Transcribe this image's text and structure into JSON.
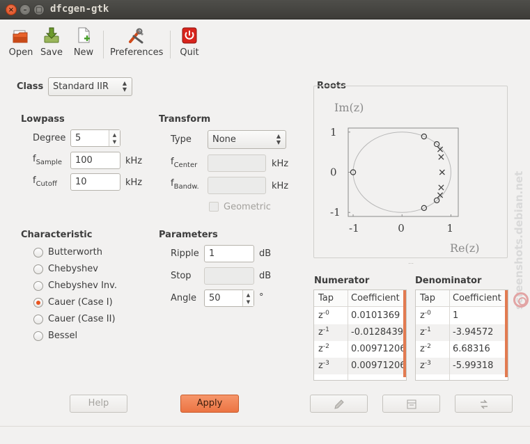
{
  "window": {
    "title": "dfcgen-gtk"
  },
  "toolbar": {
    "open": "Open",
    "save": "Save",
    "new": "New",
    "preferences": "Preferences",
    "quit": "Quit"
  },
  "class": {
    "label": "Class",
    "value": "Standard IIR"
  },
  "lowpass": {
    "heading": "Lowpass",
    "degree_label": "Degree",
    "degree_value": "5",
    "fsample_f": "f",
    "fsample_sub": "Sample",
    "fsample_value": "100",
    "fsample_unit": "kHz",
    "fcutoff_f": "f",
    "fcutoff_sub": "Cutoff",
    "fcutoff_value": "10",
    "fcutoff_unit": "kHz"
  },
  "transform": {
    "heading": "Transform",
    "type_label": "Type",
    "type_value": "None",
    "fcenter_f": "f",
    "fcenter_sub": "Center",
    "fcenter_unit": "kHz",
    "fbandw_f": "f",
    "fbandw_sub": "Bandw.",
    "fbandw_unit": "kHz",
    "geometric_label": "Geometric"
  },
  "characteristic": {
    "heading": "Characteristic",
    "options": [
      "Butterworth",
      "Chebyshev",
      "Chebyshev Inv.",
      "Cauer (Case I)",
      "Cauer (Case II)",
      "Bessel"
    ],
    "selected_index": 3
  },
  "parameters": {
    "heading": "Parameters",
    "ripple_label": "Ripple",
    "ripple_value": "1",
    "ripple_unit": "dB",
    "stop_label": "Stop",
    "stop_unit": "dB",
    "angle_label": "Angle",
    "angle_value": "50",
    "angle_unit": "°"
  },
  "roots": {
    "heading": "Roots",
    "ylabel": "Im(z)",
    "xlabel": "Re(z)",
    "yticks": [
      "1",
      "0",
      "-1"
    ],
    "xticks": [
      "-1",
      "0",
      "1"
    ],
    "zeros": [
      [
        -1.0,
        0.0
      ],
      [
        0.45,
        0.89
      ],
      [
        0.45,
        -0.89
      ],
      [
        0.71,
        0.7
      ],
      [
        0.71,
        -0.7
      ]
    ],
    "poles": [
      [
        0.78,
        0.57
      ],
      [
        0.78,
        -0.57
      ],
      [
        0.8,
        0.38
      ],
      [
        0.8,
        -0.38
      ],
      [
        0.82,
        0.0
      ]
    ]
  },
  "numerator": {
    "heading": "Numerator",
    "col_tap": "Tap",
    "col_coef": "Coefficient",
    "rows": [
      {
        "base": "z",
        "exp": "-0",
        "coef": "0.0101369"
      },
      {
        "base": "z",
        "exp": "-1",
        "coef": "-0.0128439"
      },
      {
        "base": "z",
        "exp": "-2",
        "coef": "0.00971206"
      },
      {
        "base": "z",
        "exp": "-3",
        "coef": "0.00971206"
      }
    ]
  },
  "denominator": {
    "heading": "Denominator",
    "col_tap": "Tap",
    "col_coef": "Coefficient",
    "rows": [
      {
        "base": "z",
        "exp": "-0",
        "coef": "1"
      },
      {
        "base": "z",
        "exp": "-1",
        "coef": "-3.94572"
      },
      {
        "base": "z",
        "exp": "-2",
        "coef": "6.68316"
      },
      {
        "base": "z",
        "exp": "-3",
        "coef": "-5.99318"
      }
    ]
  },
  "buttons": {
    "help": "Help",
    "apply": "Apply",
    "edit_icon": "pencil-icon",
    "calc_icon": "calculator-icon",
    "swap_icon": "swap-icon"
  },
  "watermark": {
    "text": "screenshots.debian.net"
  },
  "colors": {
    "accent": "#e9541f",
    "apply": "#ec7443"
  }
}
